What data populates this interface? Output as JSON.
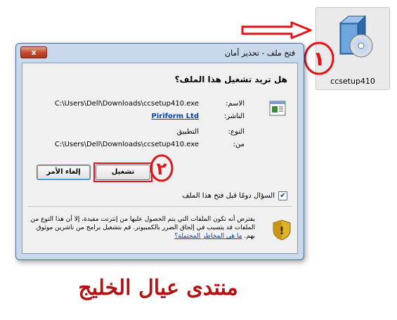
{
  "file_icon": {
    "name": "ccsetup410",
    "icon": "installer-cd-icon"
  },
  "annotations": {
    "one": "١",
    "two": "٢",
    "arrow": "arrow-right-icon"
  },
  "dialog": {
    "title": "فتح ملف - تحذير أمان",
    "close_label": "x",
    "question": "هل تريد تشغيل هذا الملف؟",
    "fields": [
      {
        "label": "الاسم:",
        "value": "C:\\Users\\Dell\\Downloads\\ccsetup410.exe",
        "link": false
      },
      {
        "label": "الناشر:",
        "value": "Piriform Ltd",
        "link": true
      },
      {
        "label": "النوع:",
        "value": "التطبيق",
        "link": false
      },
      {
        "label": "من:",
        "value": "C:\\Users\\Dell\\Downloads\\ccsetup410.exe",
        "link": false
      }
    ],
    "run_button": "تشغيل",
    "cancel_button": "إلغاء الأمر",
    "checkbox_label": "السؤال دومًا قبل فتح هذا الملف",
    "checkbox_checked": true,
    "warning_text": "يفترض أنه تكون الملفات التي يتم الحصول عليها من إنترنت مفيدة، إلا أن هذا النوع من الملفات قد يتسبب في إلحاق الضرر بالكمبيوتر. قم بتشغيل برامج من ناشرين موثوق بهم.",
    "warning_link": "ما هي المخاطر المحتملة؟"
  },
  "footer_text": "منتدى عيال الخليج",
  "colors": {
    "annotation_red": "#e0151b",
    "link_blue": "#0645ad",
    "footer_red": "#b31212"
  }
}
